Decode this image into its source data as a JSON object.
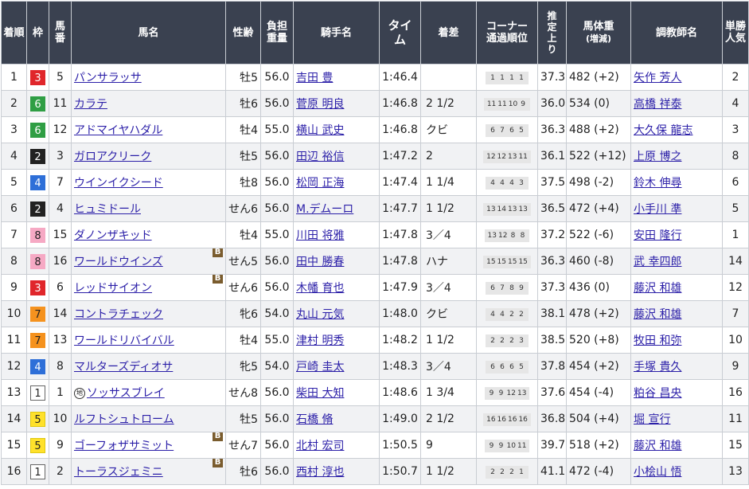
{
  "headers": {
    "rank": [
      "着順"
    ],
    "waku": [
      "枠"
    ],
    "umaban": [
      "馬",
      "番"
    ],
    "horse": [
      "馬名"
    ],
    "sexage": [
      "性齢"
    ],
    "weight": [
      "負担",
      "重量"
    ],
    "jockey": [
      "騎手名"
    ],
    "time": [
      "タイ",
      "ム"
    ],
    "margin": [
      "着差"
    ],
    "corner": [
      "コーナー",
      "通過順位"
    ],
    "last3f": [
      "推",
      "定",
      "上",
      "り"
    ],
    "bodyweight": [
      "馬体重",
      "(増減)"
    ],
    "trainer": [
      "調教師名"
    ],
    "popularity": [
      "単勝",
      "人気"
    ]
  },
  "waku_colors": {
    "1": {
      "bg": "#ffffff",
      "fg": "#222222",
      "border": "#666666"
    },
    "2": {
      "bg": "#222222",
      "fg": "#ffffff",
      "border": "#222222"
    },
    "3": {
      "bg": "#e0262b",
      "fg": "#ffffff",
      "border": "#e0262b"
    },
    "4": {
      "bg": "#2e6fd8",
      "fg": "#ffffff",
      "border": "#2e6fd8"
    },
    "5": {
      "bg": "#ffe12b",
      "fg": "#222222",
      "border": "#e0c810"
    },
    "6": {
      "bg": "#2f9e44",
      "fg": "#ffffff",
      "border": "#2f9e44"
    },
    "7": {
      "bg": "#f5921e",
      "fg": "#222222",
      "border": "#f5921e"
    },
    "8": {
      "bg": "#f6a9c4",
      "fg": "#222222",
      "border": "#f6a9c4"
    }
  },
  "rows": [
    {
      "rank": "1",
      "waku": "3",
      "umaban": "5",
      "horse": "パンサラッサ",
      "blinker": "",
      "local": "",
      "sexage": "牡5",
      "weight": "56.0",
      "jockey": "吉田 豊",
      "time": "1:46.4",
      "margin": "",
      "corner": [
        "1",
        "1",
        "1",
        "1"
      ],
      "last3f": "37.3",
      "bodyweight": "482 (+2)",
      "trainer": "矢作 芳人",
      "pop": "2"
    },
    {
      "rank": "2",
      "waku": "6",
      "umaban": "11",
      "horse": "カラテ",
      "blinker": "",
      "local": "",
      "sexage": "牡6",
      "weight": "56.0",
      "jockey": "菅原 明良",
      "time": "1:46.8",
      "margin": "2 1/2",
      "corner": [
        "11",
        "11",
        "10",
        "9"
      ],
      "last3f": "36.0",
      "bodyweight": "534 (0)",
      "trainer": "高橋 祥泰",
      "pop": "4"
    },
    {
      "rank": "3",
      "waku": "6",
      "umaban": "12",
      "horse": "アドマイヤハダル",
      "blinker": "",
      "local": "",
      "sexage": "牡4",
      "weight": "55.0",
      "jockey": "横山 武史",
      "time": "1:46.8",
      "margin": "クビ",
      "corner": [
        "6",
        "7",
        "6",
        "5"
      ],
      "last3f": "36.3",
      "bodyweight": "488 (+2)",
      "trainer": "大久保 龍志",
      "pop": "3"
    },
    {
      "rank": "4",
      "waku": "2",
      "umaban": "3",
      "horse": "ガロアクリーク",
      "blinker": "",
      "local": "",
      "sexage": "牡5",
      "weight": "56.0",
      "jockey": "田辺 裕信",
      "time": "1:47.2",
      "margin": "2",
      "corner": [
        "12",
        "12",
        "13",
        "11"
      ],
      "last3f": "36.1",
      "bodyweight": "522 (+12)",
      "trainer": "上原 博之",
      "pop": "8"
    },
    {
      "rank": "5",
      "waku": "4",
      "umaban": "7",
      "horse": "ウインイクシード",
      "blinker": "",
      "local": "",
      "sexage": "牡8",
      "weight": "56.0",
      "jockey": "松岡 正海",
      "time": "1:47.4",
      "margin": "1 1/4",
      "corner": [
        "4",
        "4",
        "4",
        "3"
      ],
      "last3f": "37.5",
      "bodyweight": "498 (-2)",
      "trainer": "鈴木 伸尋",
      "pop": "6"
    },
    {
      "rank": "6",
      "waku": "2",
      "umaban": "4",
      "horse": "ヒュミドール",
      "blinker": "",
      "local": "",
      "sexage": "せん6",
      "weight": "56.0",
      "jockey": "M.デムーロ",
      "time": "1:47.7",
      "margin": "1 1/2",
      "corner": [
        "13",
        "14",
        "13",
        "13"
      ],
      "last3f": "36.5",
      "bodyweight": "472 (+4)",
      "trainer": "小手川 準",
      "pop": "5"
    },
    {
      "rank": "7",
      "waku": "8",
      "umaban": "15",
      "horse": "ダノンザキッド",
      "blinker": "",
      "local": "",
      "sexage": "牡4",
      "weight": "55.0",
      "jockey": "川田 将雅",
      "time": "1:47.8",
      "margin": "3／4",
      "corner": [
        "13",
        "12",
        "8",
        "8"
      ],
      "last3f": "37.2",
      "bodyweight": "522 (-6)",
      "trainer": "安田 隆行",
      "pop": "1"
    },
    {
      "rank": "8",
      "waku": "8",
      "umaban": "16",
      "horse": "ワールドウインズ",
      "blinker": "B",
      "local": "",
      "sexage": "せん5",
      "weight": "56.0",
      "jockey": "田中 勝春",
      "time": "1:47.8",
      "margin": "ハナ",
      "corner": [
        "15",
        "15",
        "15",
        "15"
      ],
      "last3f": "36.3",
      "bodyweight": "460 (-8)",
      "trainer": "武 幸四郎",
      "pop": "14"
    },
    {
      "rank": "9",
      "waku": "3",
      "umaban": "6",
      "horse": "レッドサイオン",
      "blinker": "B",
      "local": "",
      "sexage": "せん6",
      "weight": "56.0",
      "jockey": "木幡 育也",
      "time": "1:47.9",
      "margin": "3／4",
      "corner": [
        "6",
        "7",
        "8",
        "9"
      ],
      "last3f": "37.3",
      "bodyweight": "436 (0)",
      "trainer": "藤沢 和雄",
      "pop": "12"
    },
    {
      "rank": "10",
      "waku": "7",
      "umaban": "14",
      "horse": "コントラチェック",
      "blinker": "",
      "local": "",
      "sexage": "牝6",
      "weight": "54.0",
      "jockey": "丸山 元気",
      "time": "1:48.0",
      "margin": "クビ",
      "corner": [
        "4",
        "4",
        "2",
        "2"
      ],
      "last3f": "38.1",
      "bodyweight": "478 (+2)",
      "trainer": "藤沢 和雄",
      "pop": "7"
    },
    {
      "rank": "11",
      "waku": "7",
      "umaban": "13",
      "horse": "ワールドリバイバル",
      "blinker": "",
      "local": "",
      "sexage": "牡4",
      "weight": "55.0",
      "jockey": "津村 明秀",
      "time": "1:48.2",
      "margin": "1 1/2",
      "corner": [
        "2",
        "2",
        "2",
        "3"
      ],
      "last3f": "38.5",
      "bodyweight": "520 (+8)",
      "trainer": "牧田 和弥",
      "pop": "10"
    },
    {
      "rank": "12",
      "waku": "4",
      "umaban": "8",
      "horse": "マルターズディオサ",
      "blinker": "",
      "local": "",
      "sexage": "牝5",
      "weight": "54.0",
      "jockey": "戸崎 圭太",
      "time": "1:48.3",
      "margin": "3／4",
      "corner": [
        "6",
        "6",
        "6",
        "5"
      ],
      "last3f": "37.8",
      "bodyweight": "454 (+2)",
      "trainer": "手塚 貴久",
      "pop": "9"
    },
    {
      "rank": "13",
      "waku": "1",
      "umaban": "1",
      "horse": "ソッサスブレイ",
      "blinker": "",
      "local": "地",
      "sexage": "せん8",
      "weight": "56.0",
      "jockey": "柴田 大知",
      "time": "1:48.6",
      "margin": "1 3/4",
      "corner": [
        "9",
        "9",
        "12",
        "13"
      ],
      "last3f": "37.6",
      "bodyweight": "454 (-4)",
      "trainer": "粕谷 昌央",
      "pop": "16"
    },
    {
      "rank": "14",
      "waku": "5",
      "umaban": "10",
      "horse": "ルフトシュトローム",
      "blinker": "",
      "local": "",
      "sexage": "牡5",
      "weight": "56.0",
      "jockey": "石橋 脩",
      "time": "1:49.0",
      "margin": "2 1/2",
      "corner": [
        "16",
        "16",
        "16",
        "16"
      ],
      "last3f": "36.8",
      "bodyweight": "504 (+4)",
      "trainer": "堀 宣行",
      "pop": "11"
    },
    {
      "rank": "15",
      "waku": "5",
      "umaban": "9",
      "horse": "ゴーフォザサミット",
      "blinker": "B",
      "local": "",
      "sexage": "せん7",
      "weight": "56.0",
      "jockey": "北村 宏司",
      "time": "1:50.5",
      "margin": "9",
      "corner": [
        "9",
        "9",
        "10",
        "11"
      ],
      "last3f": "39.7",
      "bodyweight": "518 (+2)",
      "trainer": "藤沢 和雄",
      "pop": "15"
    },
    {
      "rank": "16",
      "waku": "1",
      "umaban": "2",
      "horse": "トーラスジェミニ",
      "blinker": "B",
      "local": "",
      "sexage": "牡6",
      "weight": "56.0",
      "jockey": "西村 淳也",
      "time": "1:50.7",
      "margin": "1 1/2",
      "corner": [
        "2",
        "2",
        "2",
        "1"
      ],
      "last3f": "41.1",
      "bodyweight": "472 (-4)",
      "trainer": "小桧山 悟",
      "pop": "13"
    }
  ]
}
